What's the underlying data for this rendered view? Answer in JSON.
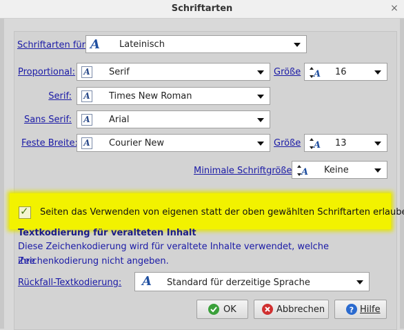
{
  "window": {
    "title": "Schriftarten",
    "close_glyph": "×"
  },
  "fonts_for": {
    "label": "Schriftarten für:",
    "value": "Lateinisch"
  },
  "proportional": {
    "label": "Proportional:",
    "value": "Serif",
    "size_label": "Größe",
    "size_value": "16"
  },
  "serif": {
    "label": "Serif:",
    "value": "Times New Roman"
  },
  "sans_serif": {
    "label": "Sans Serif:",
    "value": "Arial"
  },
  "monospace": {
    "label": "Feste Breite:",
    "value": "Courier New",
    "size_label": "Größe",
    "size_value": "13"
  },
  "min_size": {
    "label": "Minimale Schriftgröße:",
    "value": "Keine"
  },
  "allow_fonts": {
    "checked": true,
    "label": "Seiten das Verwenden von eigenen statt der oben gewählten Schriftarten erlauben"
  },
  "encoding": {
    "heading": "Textkodierung für veralteten Inhalt",
    "description_line1": "Diese Zeichenkodierung wird für veraltete Inhalte verwendet, welche ihre",
    "description_line2": "Zeichenkodierung nicht angeben.",
    "fallback_label": "Rückfall-Textkodierung:",
    "fallback_value": "Standard für derzeitige Sprache"
  },
  "buttons": {
    "ok": "OK",
    "cancel": "Abbrechen",
    "help": "Hilfe"
  },
  "colors": {
    "highlight": "#f2f200",
    "link_blue": "#1a1aa6",
    "ok_green": "#3aa03a",
    "cancel_red": "#d03030",
    "help_blue": "#2a6acf"
  }
}
